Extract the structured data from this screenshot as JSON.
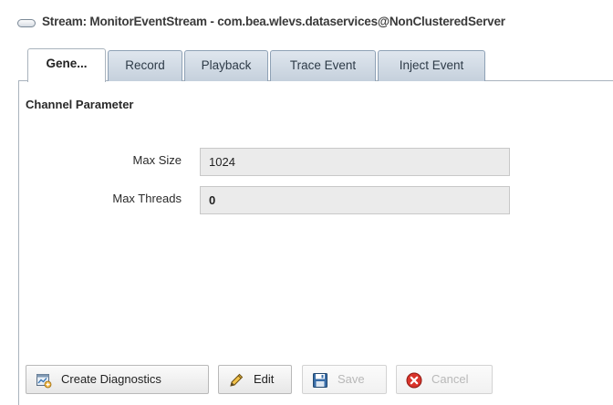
{
  "header": {
    "title": "Stream: MonitorEventStream - com.bea.wlevs.dataservices@NonClusteredServer"
  },
  "tabs": [
    {
      "label": "Gene...",
      "active": true
    },
    {
      "label": "Record",
      "active": false
    },
    {
      "label": "Playback",
      "active": false
    },
    {
      "label": "Trace Event",
      "active": false
    },
    {
      "label": "Inject Event",
      "active": false
    }
  ],
  "section": {
    "title": "Channel Parameter"
  },
  "fields": [
    {
      "label": "Max Size",
      "value": "1024"
    },
    {
      "label": "Max Threads",
      "value": "0"
    }
  ],
  "buttons": [
    {
      "label": "Create Diagnostics",
      "enabled": true,
      "icon": "diagnostics-icon"
    },
    {
      "label": "Edit",
      "enabled": true,
      "icon": "pencil-icon"
    },
    {
      "label": "Save",
      "enabled": false,
      "icon": "floppy-disk-icon"
    },
    {
      "label": "Cancel",
      "enabled": false,
      "icon": "cancel-icon"
    }
  ],
  "colors": {
    "tab_fill": "#c5d0dc",
    "tab_border": "#8ea1b5",
    "field_background": "#ebebeb",
    "cancel_red": "#d9342b"
  }
}
